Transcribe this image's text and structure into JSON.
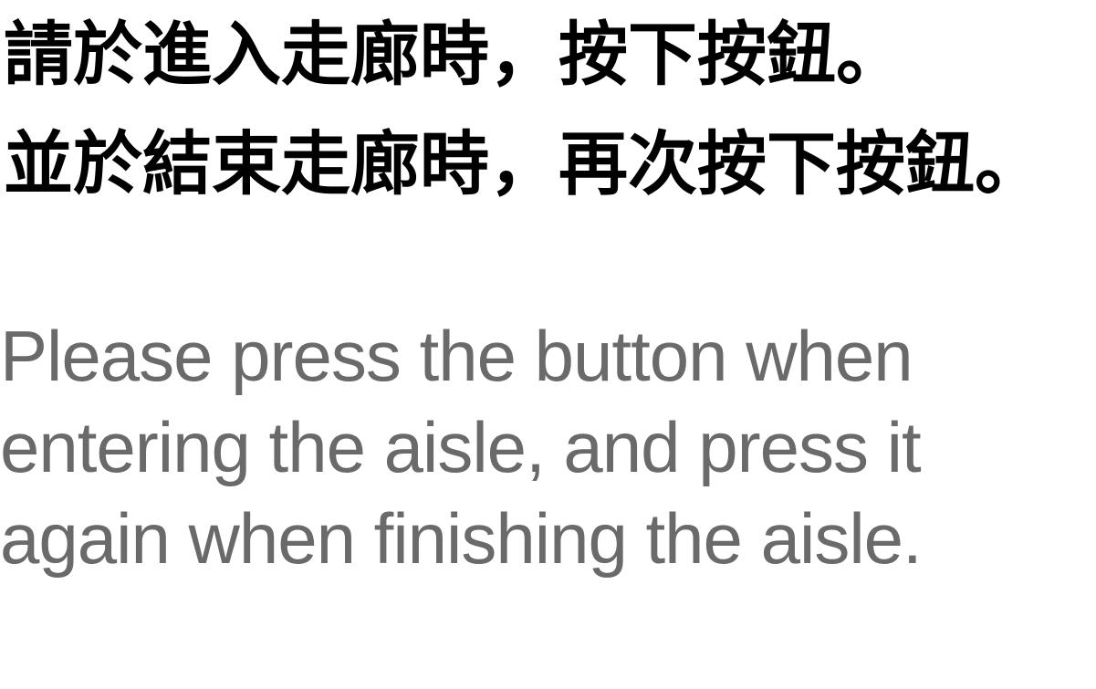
{
  "instructions": {
    "chinese_lines": [
      "請於進入走廊時，按下按鈕。",
      "並於結束走廊時，再次按下按鈕。"
    ],
    "english_lines": [
      "Please press the button when",
      "entering the aisle, and press it",
      "again when finishing the aisle."
    ]
  },
  "colors": {
    "chinese_text": "#000000",
    "english_text": "#6a6a6a",
    "background": "#ffffff"
  }
}
